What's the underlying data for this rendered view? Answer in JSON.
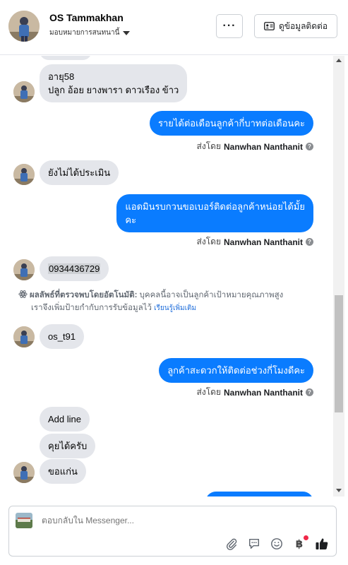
{
  "header": {
    "contact_name": "OS Tammakhan",
    "assign_label": "มอบหมายการสนทนานี้",
    "more_label": "···",
    "contact_info_label": "ดูข้อมูลติดต่อ"
  },
  "messages": [
    {
      "dir": "in",
      "lines": [
        "อายุ58",
        "ปลูก อ้อย ยางพารา ดาวเรือง ข้าว"
      ]
    },
    {
      "dir": "out",
      "lines": [
        "รายได้ต่อเดือนลูกค้ากี่บาทต่อเดือนคะ"
      ],
      "sent_by_prefix": "ส่งโดย",
      "sent_by_name": "Nanwhan Nanthanit"
    },
    {
      "dir": "in",
      "lines": [
        "ยังไม่ได้ประเมิน"
      ]
    },
    {
      "dir": "out",
      "lines": [
        "แอดมินรบกวนขอเบอร์ติดต่อลูกค้าหน่อยได้มั้ย",
        "คะ"
      ],
      "sent_by_prefix": "ส่งโดย",
      "sent_by_name": "Nanwhan Nanthanit"
    },
    {
      "dir": "in",
      "lines": [
        "0934436729"
      ]
    },
    {
      "dir": "in",
      "lines": [
        "os_t91"
      ]
    },
    {
      "dir": "out",
      "lines": [
        "ลูกค้าสะดวกให้ติดต่อช่วงกี่โมงดีคะ"
      ],
      "sent_by_prefix": "ส่งโดย",
      "sent_by_name": "Nanwhan Nanthanit"
    },
    {
      "dir": "in",
      "lines": [
        "Add line"
      ]
    },
    {
      "dir": "in",
      "lines": [
        "คุยได้ครับ"
      ]
    },
    {
      "dir": "in",
      "lines": [
        "ขอแก่น"
      ]
    }
  ],
  "auto_detect": {
    "title": "ผลลัพธ์ที่ตรวจพบโดยอัตโนมัติ:",
    "line1": "บุคคลนี้อาจเป็นลูกค้าเป้าหมายคุณภาพสูง",
    "line2": "เราจึงเพิ่มป้ายกำกับการรับข้อมูลไว้",
    "link": "เรียนรู้เพิ่มเติม"
  },
  "composer": {
    "placeholder": "ตอบกลับใน Messenger...",
    "tools": [
      "attachment-icon",
      "saved-reply-icon",
      "emoji-icon",
      "payment-icon",
      "like-icon"
    ],
    "baht_symbol": "฿"
  },
  "colors": {
    "outgoing_bubble": "#0a7cff",
    "incoming_bubble": "#e4e6eb",
    "link": "#216fdb",
    "notification_dot": "#f02849"
  }
}
